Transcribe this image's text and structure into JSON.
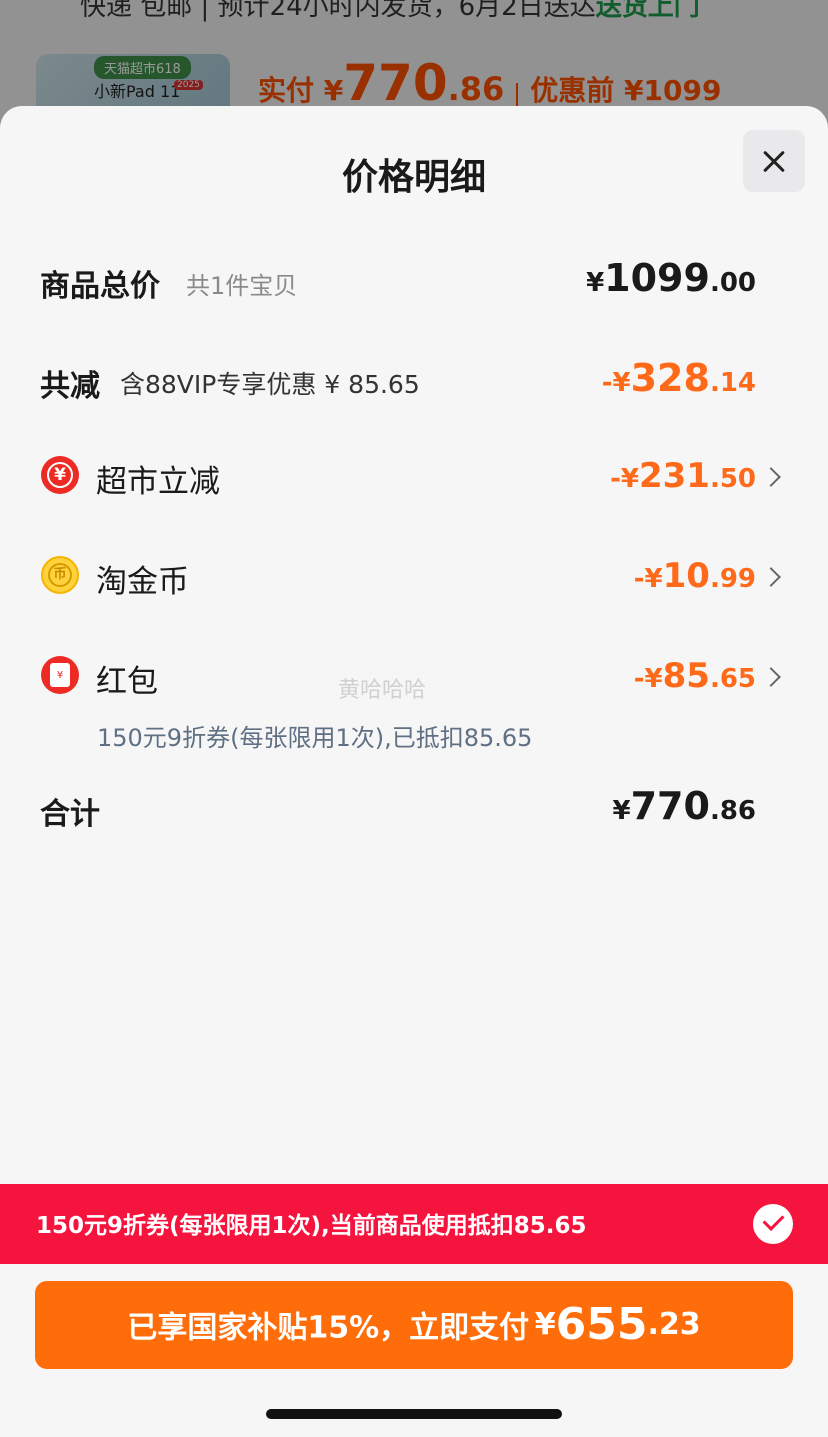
{
  "background": {
    "top_line": "快递 包邮 | 预计24小时内发货，6月2日送达",
    "top_line_green": "送货上门",
    "thumb_badge": "天猫超市618",
    "thumb_name": "小新Pad 11",
    "thumb_tag": "2025",
    "paid_label": "实付 ¥",
    "paid_int": "770",
    "paid_dec": ".86",
    "orig_label": "优惠前 ¥1099"
  },
  "sheet": {
    "title": "价格明细",
    "close_icon": "close-icon"
  },
  "total_goods": {
    "label": "商品总价",
    "sub": "共1件宝贝",
    "cur": "¥",
    "int": "1099",
    "dec": ".00"
  },
  "total_reduce": {
    "label": "共减",
    "note": "含88VIP专享优惠 ¥ 85.65",
    "cur": "-¥",
    "int": "328",
    "dec": ".14"
  },
  "items": [
    {
      "label": "超市立减",
      "icon": "yuan-circle-icon",
      "icon_glyph": "¥",
      "cur": "-¥",
      "int": "231",
      "dec": ".50"
    },
    {
      "label": "淘金币",
      "icon": "gold-coin-icon",
      "icon_glyph": "币",
      "cur": "-¥",
      "int": "10",
      "dec": ".99"
    },
    {
      "label": "红包",
      "icon": "red-envelope-icon",
      "icon_glyph": "¥",
      "cur": "-¥",
      "int": "85",
      "dec": ".65",
      "note": "150元9折券(每张限用1次),已抵扣85.65"
    }
  ],
  "watermark": "黄哈哈哈",
  "sum": {
    "label": "合计",
    "cur": "¥",
    "int": "770",
    "dec": ".86"
  },
  "coupon_bar": {
    "text": "150元9折券(每张限用1次),当前商品使用抵扣85.65"
  },
  "pay_button": {
    "text": "已享国家补贴15%，立即支付",
    "cur": "¥",
    "int": "655",
    "dec": ".23"
  },
  "colors": {
    "accent_orange": "#ff6a1a",
    "coupon_red": "#f5143e",
    "pay_orange": "#ff6d0a"
  }
}
